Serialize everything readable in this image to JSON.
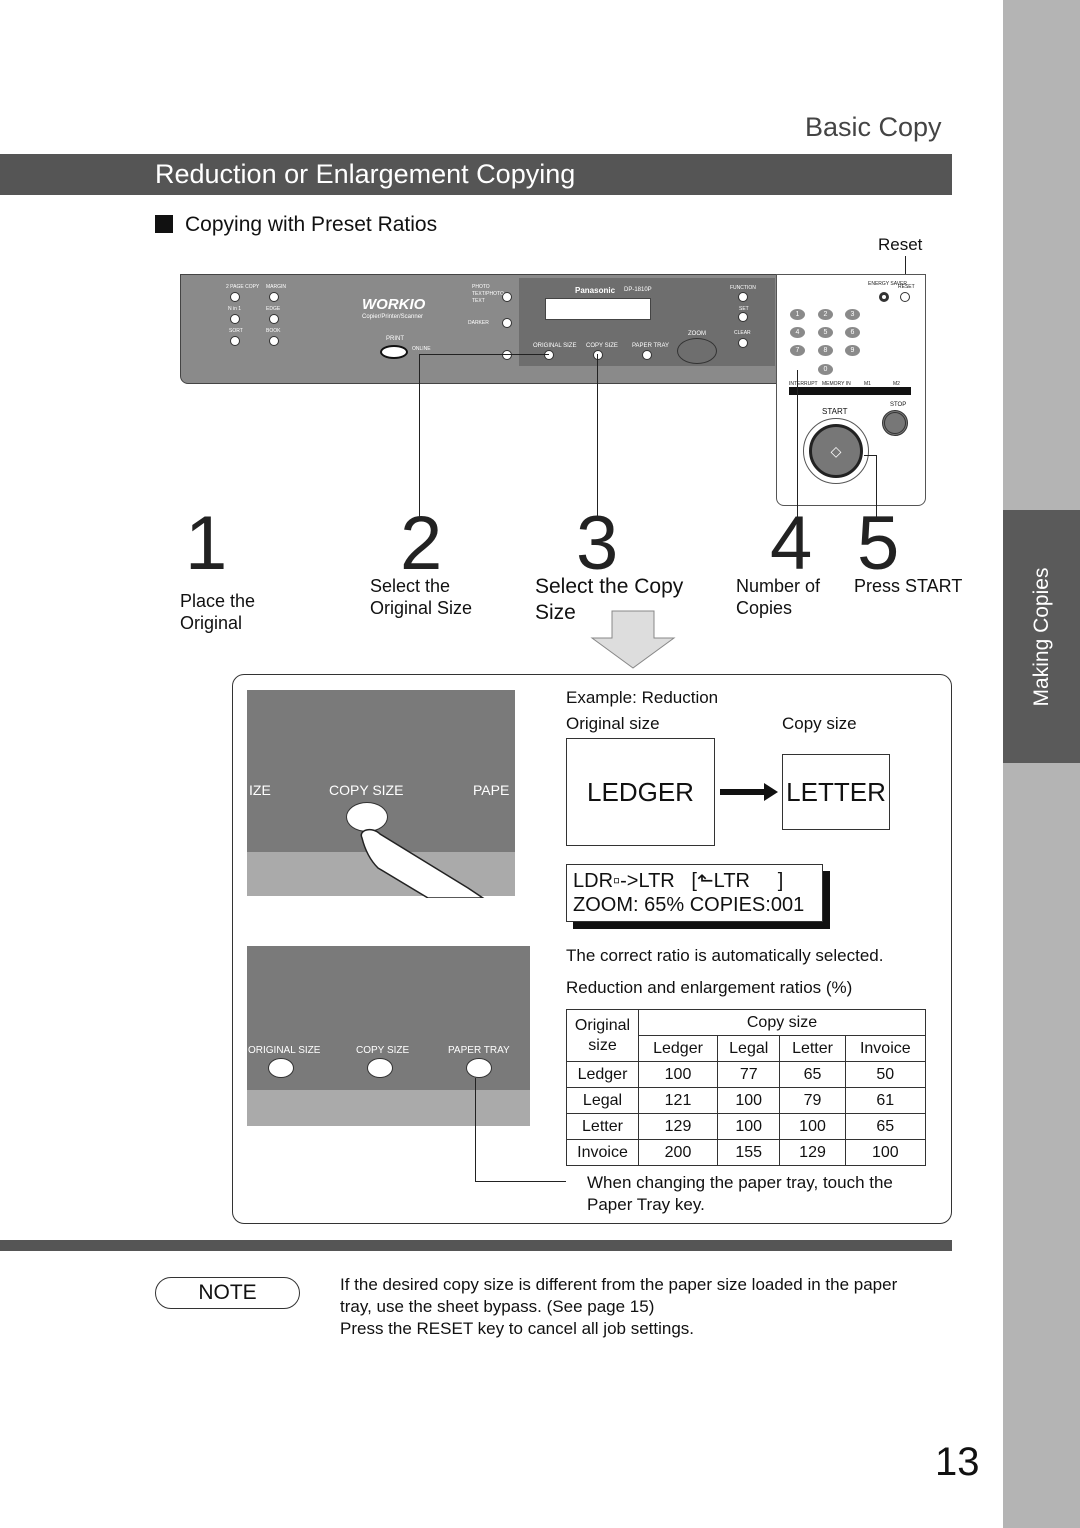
{
  "section_title": "Basic Copy",
  "band_title": "Reduction or Enlargement Copying",
  "subheading": "Copying with Preset Ratios",
  "side_tab": "Making Copies",
  "panel": {
    "reset_label": "Reset",
    "brand": "WORKIO",
    "brand_sub": "Copier/Printer/Scanner",
    "maker": "Panasonic",
    "model": "DP-1810P",
    "buttons": [
      "2 PAGE COPY",
      "MARGIN",
      "N in 1",
      "EDGE",
      "SORT",
      "BOOK",
      "PHOTO",
      "TEXT/PHOTO",
      "TEXT",
      "DARKER",
      "PRINT",
      "ONLINE",
      "ORIGINAL SIZE",
      "COPY SIZE",
      "PAPER TRAY",
      "ZOOM",
      "FUNCTION",
      "SET",
      "CLEAR",
      "ENERGY SAVER",
      "RESET",
      "INTERRUPT",
      "MEMORY IN",
      "M1",
      "M2",
      "START",
      "STOP"
    ],
    "keys": [
      "1",
      "2",
      "3",
      "4",
      "5",
      "6",
      "7",
      "8",
      "9",
      "0"
    ]
  },
  "steps": [
    {
      "num": "1",
      "text": "Place the Original"
    },
    {
      "num": "2",
      "text": "Select the Original Size"
    },
    {
      "num": "3",
      "text": "Select the Copy Size"
    },
    {
      "num": "4",
      "text": "Number of Copies"
    },
    {
      "num": "5",
      "text": "Press START"
    }
  ],
  "example": {
    "photo1": {
      "left": "IZE",
      "center": "COPY SIZE",
      "right": "PAPE"
    },
    "photo2": {
      "labels": [
        "ORIGINAL SIZE",
        "COPY SIZE",
        "PAPER TRAY"
      ]
    },
    "title": "Example: Reduction",
    "orig_label": "Original size",
    "copy_label": "Copy size",
    "orig_value": "LEDGER",
    "copy_value": "LETTER",
    "lcd_line1": "LDR▫->LTR   [⬑LTR     ]",
    "lcd_line2": "ZOOM: 65% COPIES:001",
    "auto_text": "The correct ratio is automatically selected.",
    "table_title": "Reduction and enlargement ratios (%)",
    "table_header_orig": "Original size",
    "table_header_copy": "Copy size",
    "columns": [
      "Ledger",
      "Legal",
      "Letter",
      "Invoice"
    ],
    "rows": [
      {
        "name": "Ledger",
        "values": [
          "100",
          "77",
          "65",
          "50"
        ]
      },
      {
        "name": "Legal",
        "values": [
          "121",
          "100",
          "79",
          "61"
        ]
      },
      {
        "name": "Letter",
        "values": [
          "129",
          "100",
          "100",
          "65"
        ]
      },
      {
        "name": "Invoice",
        "values": [
          "200",
          "155",
          "129",
          "100"
        ]
      }
    ],
    "tray_note": "When changing the paper tray, touch the Paper Tray  key."
  },
  "note": {
    "label": "NOTE",
    "lines": [
      "If the desired copy size is different from the paper size loaded in the paper",
      "tray, use the sheet bypass. (See page 15)",
      "Press the RESET key to cancel all job settings."
    ]
  },
  "page_number": "13"
}
